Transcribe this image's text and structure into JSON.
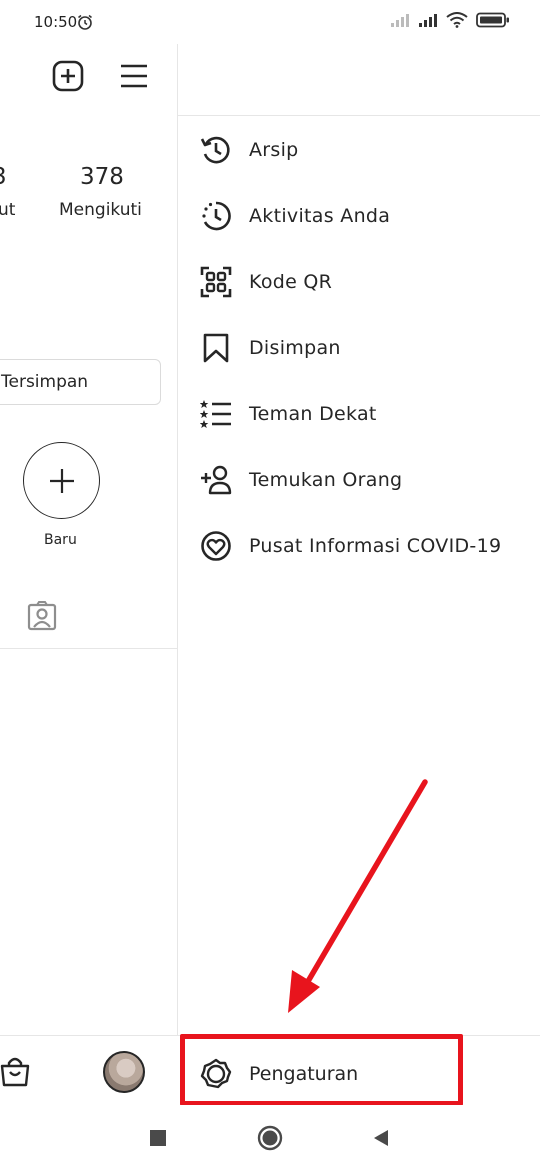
{
  "status_bar": {
    "time": "10:50",
    "icons": [
      "alarm-icon",
      "signal-icon",
      "signal-icon",
      "wifi-icon",
      "battery-icon"
    ]
  },
  "profile": {
    "header_icons": [
      "new-post-icon",
      "menu-icon"
    ],
    "stats": [
      {
        "number": "3",
        "label": "ut"
      },
      {
        "number": "378",
        "label": "Mengikuti"
      }
    ],
    "saved_button_label": "Tersimpan",
    "new_highlight_label": "Baru",
    "tagged_icon": "tagged-icon"
  },
  "bottom_nav": {
    "icons": [
      "shop-icon",
      "profile-avatar"
    ]
  },
  "drawer": {
    "items": [
      {
        "label": "Arsip",
        "icon": "archive-icon"
      },
      {
        "label": "Aktivitas Anda",
        "icon": "activity-icon"
      },
      {
        "label": "Kode QR",
        "icon": "qr-code-icon"
      },
      {
        "label": "Disimpan",
        "icon": "bookmark-icon"
      },
      {
        "label": "Teman Dekat",
        "icon": "close-friends-icon"
      },
      {
        "label": "Temukan Orang",
        "icon": "discover-people-icon"
      },
      {
        "label": "Pusat Informasi COVID-19",
        "icon": "covid-info-icon"
      }
    ],
    "settings_label": "Pengaturan",
    "settings_icon": "settings-icon"
  },
  "annotation": {
    "color": "#e8141d"
  },
  "system_nav": {
    "icons": [
      "recents-icon",
      "home-icon",
      "back-icon"
    ]
  }
}
